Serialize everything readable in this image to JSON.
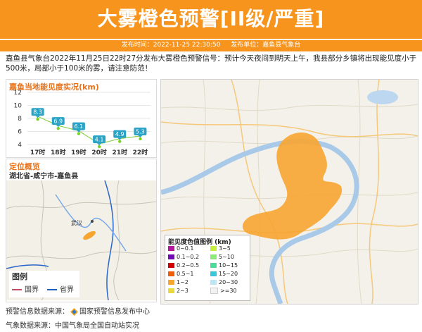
{
  "header": {
    "title": "大雾橙色预警[II级/严重]",
    "publish_time_label": "发布时间：2022-11-25 22:30:50",
    "publish_unit_label": "发布单位：嘉鱼县气象台"
  },
  "description": "嘉鱼县气象台2022年11月25日22时27分发布大雾橙色预警信号：预计今天夜间到明天上午，我县部分乡镇将出现能见度小于500米，局部小于100米的雾，请注意防范！",
  "visibility_card": {
    "title": "嘉鱼当地能见度实况(km)"
  },
  "location_card": {
    "title": "定位概览",
    "location_path": "湖北省-咸宁市-嘉鱼县",
    "city_label": "武汉",
    "legend_title": "图例",
    "legend_items": [
      {
        "label": "国界",
        "color": "#c0506a"
      },
      {
        "label": "省界",
        "color": "#1f5fbf"
      }
    ]
  },
  "visibility_legend": {
    "title": "能见度色值图例 (km)",
    "items": [
      {
        "label": "0~0.1",
        "color": "#b5179e"
      },
      {
        "label": "0.1~0.2",
        "color": "#7209b7"
      },
      {
        "label": "0.2~0.5",
        "color": "#d00000"
      },
      {
        "label": "0.5~1",
        "color": "#f25c05"
      },
      {
        "label": "1~2",
        "color": "#f7a531"
      },
      {
        "label": "2~3",
        "color": "#e9d93a"
      },
      {
        "label": "3~5",
        "color": "#c6ef3b"
      },
      {
        "label": "5~10",
        "color": "#8fe87a"
      },
      {
        "label": "10~15",
        "color": "#4ddc9a"
      },
      {
        "label": "15~20",
        "color": "#3cc6d9"
      },
      {
        "label": "20~30",
        "color": "#bde6f5"
      },
      {
        "label": ">=30",
        "color": "#f2f2f2"
      }
    ]
  },
  "footer": {
    "source1_label": "预警信息数据来源：",
    "source1_value": "国家预警信息发布中心",
    "source2": "气象数据来源：中国气象局全国自动站实况"
  },
  "colors": {
    "accent": "#f7941d",
    "fog_area": "#f7a531",
    "point_marker": "#7ed321",
    "label_box": "#2aa3c6"
  },
  "chart_data": {
    "type": "line",
    "title": "嘉鱼当地能见度实况(km)",
    "categories": [
      "17时",
      "18时",
      "19时",
      "20时",
      "21时",
      "22时"
    ],
    "values": [
      8.3,
      6.9,
      6.1,
      4.1,
      4.9,
      5.3
    ],
    "value_labels": [
      "8.3",
      "6.9",
      "6.1",
      "4.1",
      "4.9",
      "5.3"
    ],
    "y_ticks": [
      "4",
      "6",
      "8",
      "10",
      "12"
    ],
    "ylim": [
      4,
      12
    ],
    "grid": true
  }
}
